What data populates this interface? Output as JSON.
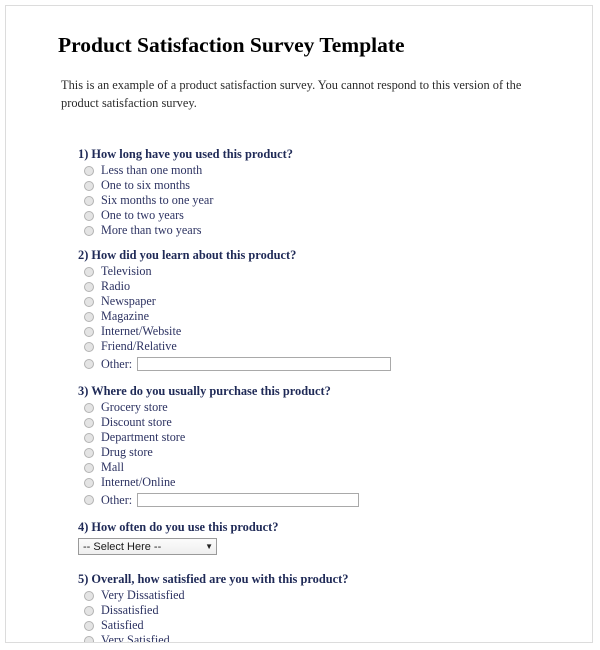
{
  "document": {
    "title": "Product Satisfaction Survey Template",
    "intro": "This is an example of a product satisfaction survey. You cannot respond to this version of the product satisfaction survey."
  },
  "colors": {
    "title_text": "#000000",
    "intro_text": "#2b2b2b",
    "question_heading": "#1f2a57",
    "option_text": "#2d3362",
    "radio_fill": "#e4e4e4",
    "radio_border": "#b3b3b3",
    "input_border": "#a9a9a9",
    "page_border": "#dcdcdc",
    "page_background": "#ffffff"
  },
  "questions": [
    {
      "number": "1)",
      "title": "1) How long have you used this product?",
      "type": "radio",
      "options": [
        {
          "label": "Less than one month"
        },
        {
          "label": "One to six months"
        },
        {
          "label": "Six months to one year"
        },
        {
          "label": "One to two years"
        },
        {
          "label": "More than two years"
        }
      ]
    },
    {
      "number": "2)",
      "title": "2) How did you learn about this product?",
      "type": "radio",
      "options": [
        {
          "label": "Television"
        },
        {
          "label": "Radio"
        },
        {
          "label": "Newspaper"
        },
        {
          "label": "Magazine"
        },
        {
          "label": "Internet/Website"
        },
        {
          "label": "Friend/Relative"
        }
      ],
      "other": {
        "label": "Other:",
        "value": "",
        "placeholder": ""
      }
    },
    {
      "number": "3)",
      "title": "3) Where do you usually purchase this product?",
      "type": "radio",
      "options": [
        {
          "label": "Grocery store"
        },
        {
          "label": "Discount store"
        },
        {
          "label": "Department store"
        },
        {
          "label": "Drug store"
        },
        {
          "label": "Mall"
        },
        {
          "label": "Internet/Online"
        }
      ],
      "other": {
        "label": "Other:",
        "value": "",
        "placeholder": ""
      }
    },
    {
      "number": "4)",
      "title": "4) How often do you use this product?",
      "type": "select",
      "select": {
        "selected": "-- Select Here --",
        "caret": "▼"
      }
    },
    {
      "number": "5)",
      "title": "5) Overall, how satisfied are you with this product?",
      "type": "radio",
      "options": [
        {
          "label": "Very Dissatisfied"
        },
        {
          "label": "Dissatisfied"
        },
        {
          "label": "Satisfied"
        },
        {
          "label": "Very Satisfied"
        }
      ]
    }
  ]
}
